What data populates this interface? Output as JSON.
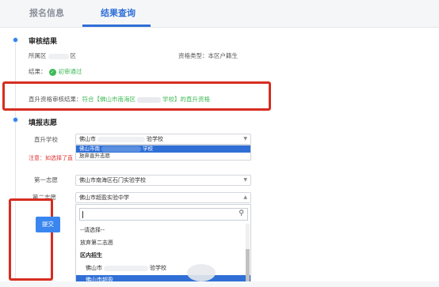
{
  "tabs": [
    {
      "label": "报名信息",
      "active": false
    },
    {
      "label": "结果查询",
      "active": true
    }
  ],
  "audit": {
    "title": "审核结果",
    "district_label": "所属区",
    "district_suffix": "区",
    "qualification_type": "资格类型：本区户籍生",
    "result_label": "结果：",
    "result_value": "初审通过",
    "direct_prefix": "直升资格审核结果：",
    "direct_value_pre": "符合【佛山市南海区",
    "direct_value_post": "学校】的直升资格"
  },
  "volunteer": {
    "title": "填报志愿",
    "direct_school_label": "直升学校",
    "direct_school_value": "佛山市",
    "direct_school_value_tail": "验学校",
    "direct_school_options": [
      "佛山市南",
      "放弃直升志愿"
    ],
    "warning": "注意：如选择了直",
    "first_label": "第一志愿",
    "first_value": "佛山市南海区石门实验学校",
    "second_label": "第二志愿",
    "second_value": "佛山市超盈实验中学",
    "second_search_placeholder": "",
    "second_options": {
      "placeholder": "--请选择--",
      "give_up": "放弃第二志愿",
      "group": "区内招生",
      "item1_pre": "佛山市",
      "item1_post": "验学校",
      "item2": "佛山市超盈"
    },
    "submit_label": "提交"
  },
  "colors": {
    "accent": "#2f6fd6",
    "success": "#3cba54",
    "warning": "#e03131",
    "highlight_box": "#d62d20"
  }
}
